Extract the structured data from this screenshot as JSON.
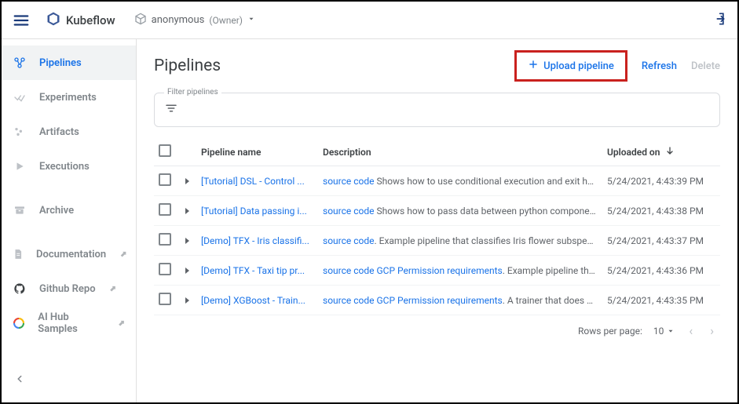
{
  "topbar": {
    "brand": "Kubeflow",
    "namespace": "anonymous",
    "owner_label": "(Owner)"
  },
  "sidebar": {
    "items": [
      {
        "label": "Pipelines",
        "icon": "share",
        "active": true
      },
      {
        "label": "Experiments",
        "icon": "check2",
        "active": false
      },
      {
        "label": "Artifacts",
        "icon": "dots",
        "active": false
      },
      {
        "label": "Executions",
        "icon": "play",
        "active": false
      },
      {
        "label": "Archive",
        "icon": "archive",
        "active": false
      }
    ],
    "external": [
      {
        "label": "Documentation",
        "icon": "doc"
      },
      {
        "label": "Github Repo",
        "icon": "github"
      },
      {
        "label": "AI Hub Samples",
        "icon": "aihub"
      }
    ]
  },
  "page": {
    "title": "Pipelines",
    "upload_label": "Upload pipeline",
    "refresh_label": "Refresh",
    "delete_label": "Delete",
    "filter_label": "Filter pipelines"
  },
  "table": {
    "headers": {
      "name": "Pipeline name",
      "desc": "Description",
      "uploaded": "Uploaded on"
    },
    "rows": [
      {
        "name": "[Tutorial] DSL - Control ...",
        "link1": "source code",
        "link2": "",
        "rest": " Shows how to use conditional execution and exit handlers. This...",
        "date": "5/24/2021, 4:43:39 PM"
      },
      {
        "name": "[Tutorial] Data passing i...",
        "link1": "source code",
        "link2": "",
        "rest": " Shows how to pass data between python components.",
        "date": "5/24/2021, 4:43:38 PM"
      },
      {
        "name": "[Demo] TFX - Iris classifi...",
        "link1": "source code",
        "link2": "",
        "rest": ". Example pipeline that classifies Iris flower subspecies and how...",
        "date": "5/24/2021, 4:43:37 PM"
      },
      {
        "name": "[Demo] TFX - Taxi tip pr...",
        "link1": "source code",
        "link2": " GCP Permission requirements",
        "rest": ". Example pipeline that does clas...",
        "date": "5/24/2021, 4:43:36 PM"
      },
      {
        "name": "[Demo] XGBoost - Train...",
        "link1": "source code",
        "link2": " GCP Permission requirements",
        "rest": ". A trainer that does end-to-end ...",
        "date": "5/24/2021, 4:43:35 PM"
      }
    ]
  },
  "pager": {
    "rows_label": "Rows per page:",
    "rows_value": "10"
  }
}
